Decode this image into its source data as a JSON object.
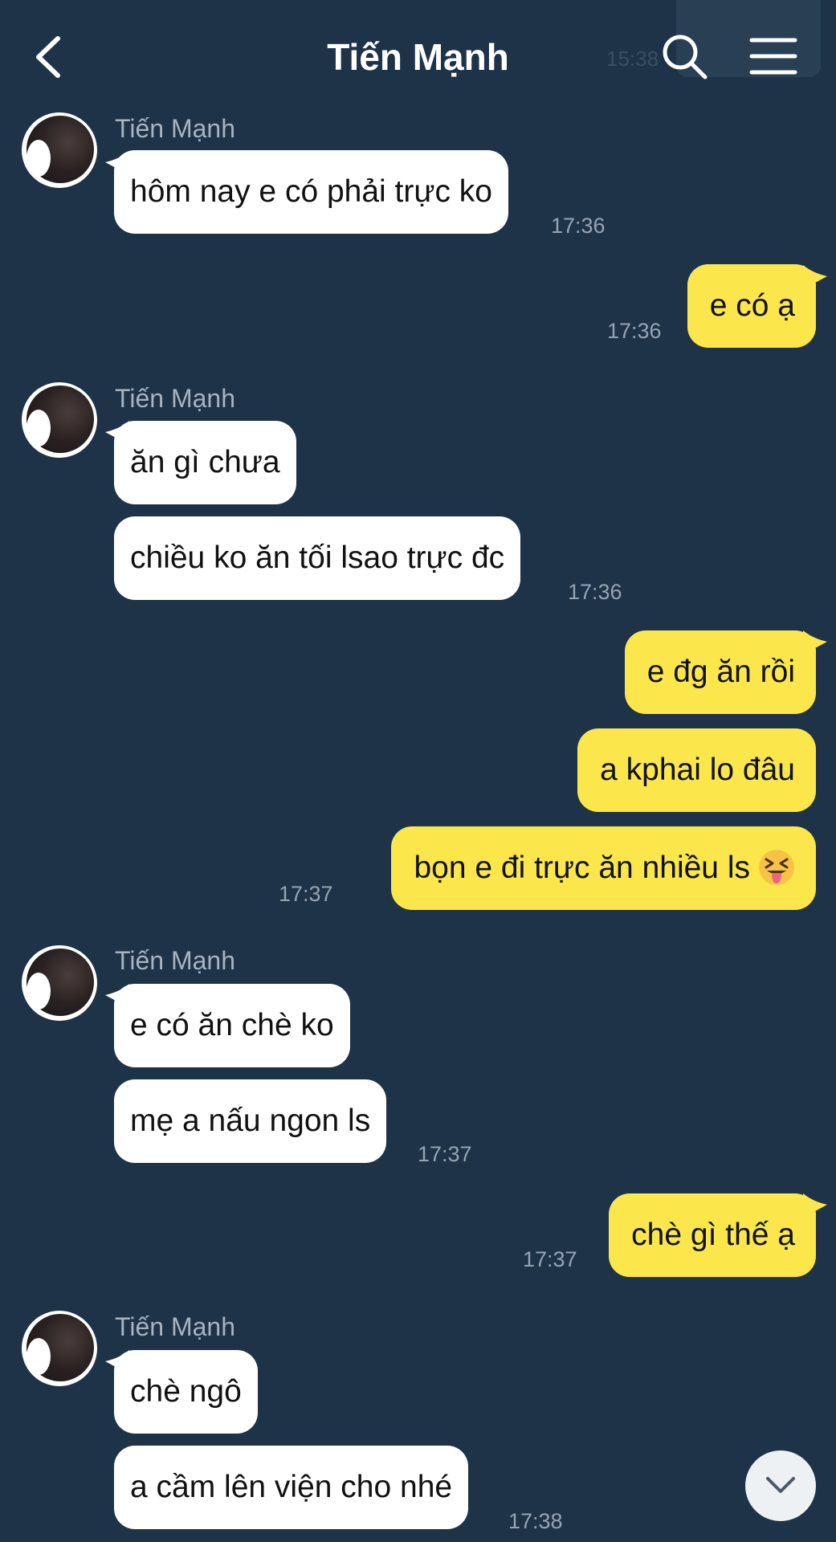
{
  "header": {
    "title": "Tiến Mạnh",
    "faded_time": "15:38"
  },
  "messages": [
    {
      "side": "in",
      "sender": "Tiến Mạnh",
      "text": "hôm nay e có phải trực ko",
      "time": "17:36"
    },
    {
      "side": "out",
      "text": "e có ạ",
      "time": "17:36"
    },
    {
      "side": "in",
      "sender": "Tiến Mạnh",
      "text": "ăn gì chưa"
    },
    {
      "side": "in",
      "text": "chiều ko ăn tối lsao trực đc",
      "time": "17:36"
    },
    {
      "side": "out",
      "text": "e đg ăn rồi"
    },
    {
      "side": "out",
      "text": "a kphai lo đâu"
    },
    {
      "side": "out",
      "text": "bọn e đi trực ăn nhiều ls",
      "emoji": "squinting-face-with-tongue",
      "time": "17:37"
    },
    {
      "side": "in",
      "sender": "Tiến Mạnh",
      "text": "e có ăn chè ko"
    },
    {
      "side": "in",
      "text": "mẹ a nấu ngon ls",
      "time": "17:37"
    },
    {
      "side": "out",
      "text": "chè gì thế ạ",
      "time": "17:37"
    },
    {
      "side": "in",
      "sender": "Tiến Mạnh",
      "text": "chè ngô"
    },
    {
      "side": "in",
      "text": "a cầm lên viện cho nhé",
      "time": "17:38"
    }
  ],
  "colors": {
    "background": "#1e3348",
    "incoming_bubble": "#ffffff",
    "outgoing_bubble": "#fbe74c",
    "timestamp": "#96a4b2",
    "sender_name": "#a7b3c0"
  },
  "icons": {
    "back": "chevron-left-icon",
    "search": "search-icon",
    "menu": "hamburger-menu-icon",
    "scroll_down": "chevron-down-icon"
  }
}
